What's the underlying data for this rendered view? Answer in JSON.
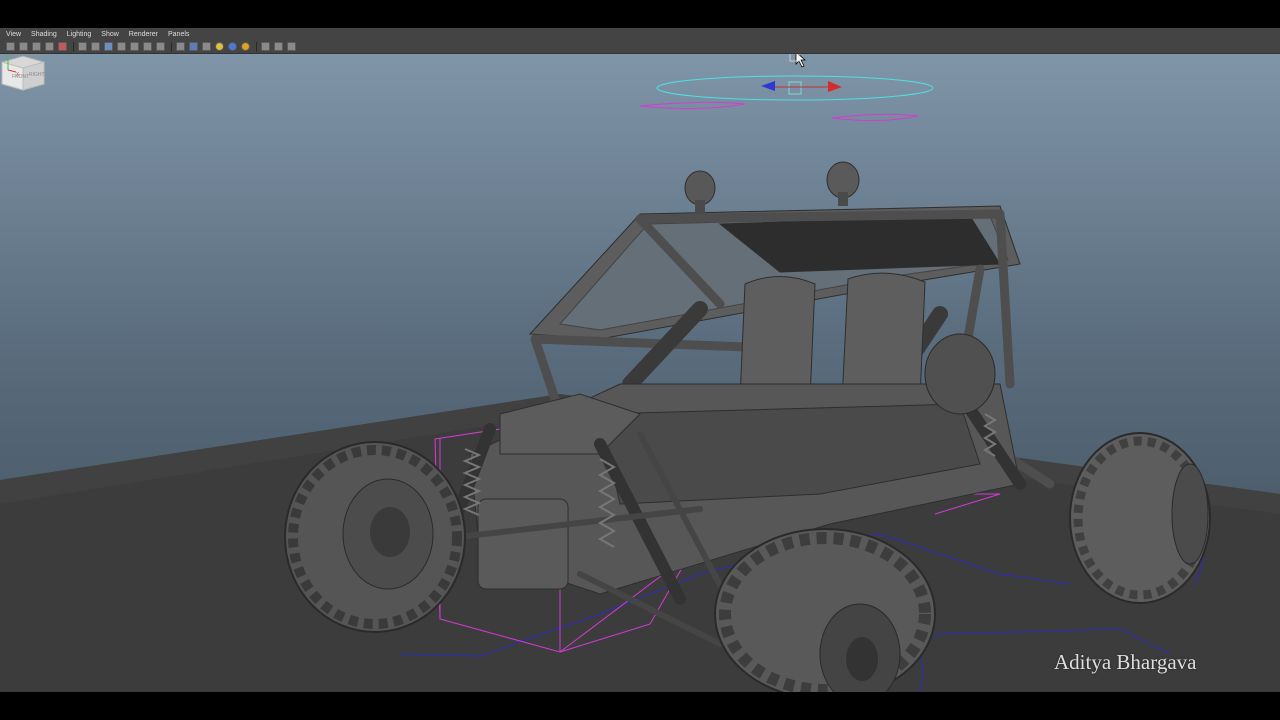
{
  "menu": {
    "items": [
      "View",
      "Shading",
      "Lighting",
      "Show",
      "Renderer",
      "Panels"
    ]
  },
  "toolbar": {
    "icons": [
      "camera-icon",
      "camera-attrs-icon",
      "bookmark-icon",
      "image-plane-icon",
      "grid-icon",
      "wireframe-icon",
      "smooth-shade-icon",
      "textured-icon",
      "lights-icon",
      "shadows-icon",
      "xray-icon",
      "isolate-icon",
      "resolution-gate-icon",
      "film-gate-icon",
      "safe-area-icon",
      "light-bulb-icon",
      "default-light-icon",
      "all-lights-icon",
      "select-icon",
      "frame-icon",
      "share-icon"
    ]
  },
  "viewcube": {
    "front_label": "FRONT",
    "right_label": "RIGHT"
  },
  "watermark": {
    "text": "Aditya Bhargava"
  },
  "axis": {
    "y_label": "Y",
    "x_label": "X"
  },
  "colors": {
    "menu_bg": "#444444",
    "viewport_top": "#7f95a8",
    "viewport_bottom": "#3d4a56",
    "floor": "#3c3c3c",
    "selection_magenta": "#d23cd2",
    "manipulator_cyan": "#4fe0e0",
    "curve_blue": "#2b2bbd"
  }
}
